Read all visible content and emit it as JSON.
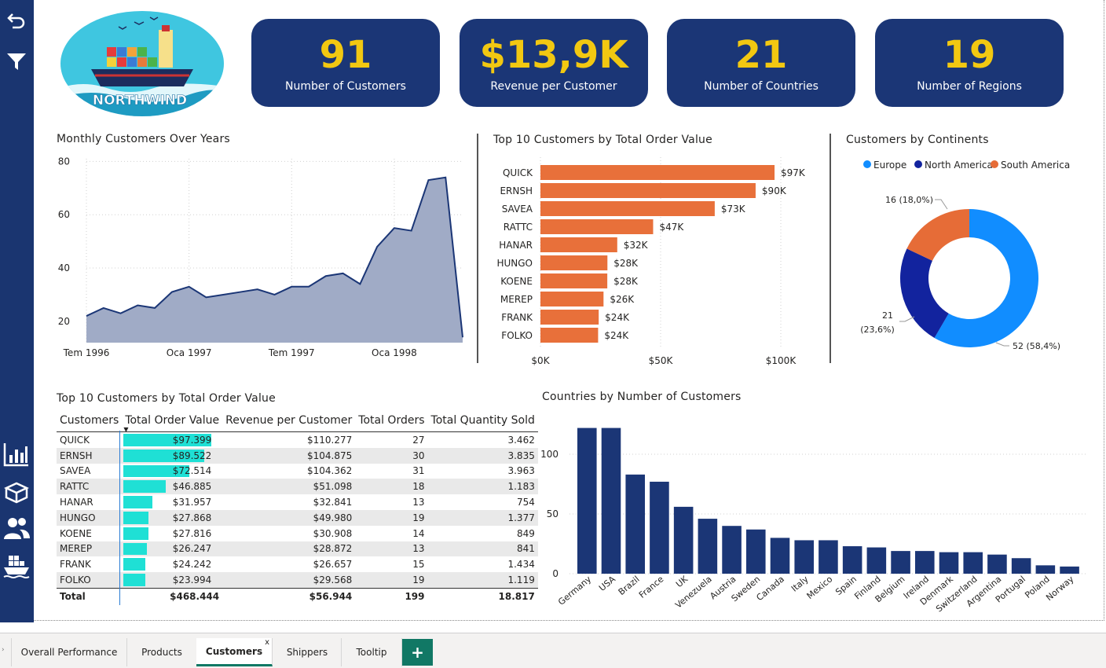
{
  "logo": {
    "text": "NORTHWIND"
  },
  "kpis": [
    {
      "value": "91",
      "label": "Number of Customers"
    },
    {
      "value": "$13,9K",
      "label": "Revenue per Customer"
    },
    {
      "value": "21",
      "label": "Number of Countries"
    },
    {
      "value": "19",
      "label": "Number of Regions"
    }
  ],
  "colors": {
    "sidebar": "#1a3570",
    "kpi_bg": "#1b3676",
    "kpi_value": "#f2c811",
    "area": "#a0abc6",
    "bar_orange": "#e8703a",
    "europe": "#118dff",
    "north_america": "#12239e",
    "south_america": "#e66c37",
    "country_bar": "#1b3676",
    "table_bar": "#1fe0d5",
    "active_tab": "#117865"
  },
  "sidebar_icons": [
    "back-arrow-icon",
    "filter-icon",
    "bar-chart-icon",
    "box-icon",
    "people-icon",
    "ship-icon"
  ],
  "chart_data": [
    {
      "type": "area",
      "title": "Monthly Customers Over Years",
      "x_tick_labels": [
        "Tem 1996",
        "Oca 1997",
        "Tem 1997",
        "Oca 1998"
      ],
      "y_ticks": [
        20,
        40,
        60,
        80
      ],
      "ylim": [
        12,
        81
      ],
      "x": [
        "1996-07",
        "1996-08",
        "1996-09",
        "1996-10",
        "1996-11",
        "1996-12",
        "1997-01",
        "1997-02",
        "1997-03",
        "1997-04",
        "1997-05",
        "1997-06",
        "1997-07",
        "1997-08",
        "1997-09",
        "1997-10",
        "1997-11",
        "1997-12",
        "1998-01",
        "1998-02",
        "1998-03",
        "1998-04",
        "1998-05"
      ],
      "values": [
        22,
        25,
        23,
        26,
        25,
        31,
        33,
        29,
        30,
        31,
        32,
        30,
        33,
        33,
        37,
        38,
        34,
        48,
        55,
        54,
        73,
        74,
        14
      ],
      "grid": true
    },
    {
      "type": "bar",
      "orientation": "horizontal",
      "title": "Top 10 Customers by Total Order Value",
      "categories": [
        "QUICK",
        "ERNSH",
        "SAVEA",
        "RATTC",
        "HANAR",
        "HUNGO",
        "KOENE",
        "MEREP",
        "FRANK",
        "FOLKO"
      ],
      "values": [
        97399,
        89522,
        72514,
        46885,
        31957,
        27868,
        27816,
        26247,
        24242,
        23994
      ],
      "data_labels": [
        "$97K",
        "$90K",
        "$73K",
        "$47K",
        "$32K",
        "$28K",
        "$28K",
        "$26K",
        "$24K",
        "$24K"
      ],
      "x_tick_labels": [
        "$0K",
        "$50K",
        "$100K"
      ],
      "xlim": [
        0,
        100000
      ],
      "grid": true
    },
    {
      "type": "pie",
      "style": "donut",
      "title": "Customers by Continents",
      "legend_position": "top",
      "categories": [
        "Europe",
        "North America",
        "South America"
      ],
      "values": [
        52,
        21,
        16
      ],
      "data_labels": [
        "52 (58,4%)",
        "21 (23,6%)",
        "16 (18,0%)"
      ]
    },
    {
      "type": "bar",
      "title": "Countries by Number of Customers",
      "categories": [
        "Germany",
        "USA",
        "Brazil",
        "France",
        "UK",
        "Venezuela",
        "Austria",
        "Sweden",
        "Canada",
        "Italy",
        "Mexico",
        "Spain",
        "Finland",
        "Belgium",
        "Ireland",
        "Denmark",
        "Switzerland",
        "Argentina",
        "Portugal",
        "Poland",
        "Norway"
      ],
      "values": [
        122,
        122,
        83,
        77,
        56,
        46,
        40,
        37,
        30,
        28,
        28,
        23,
        22,
        19,
        19,
        18,
        18,
        16,
        13,
        7,
        6
      ],
      "y_ticks": [
        0,
        50,
        100
      ],
      "ylim": [
        0,
        125
      ],
      "grid": true
    }
  ],
  "table": {
    "title": "Top 10 Customers by Total Order Value",
    "columns": [
      "Customers",
      "Total Order Value",
      "Revenue per Customer",
      "Total Orders",
      "Total Quantity Sold"
    ],
    "rows": [
      [
        "QUICK",
        "$97.399",
        "$110.277",
        "27",
        "3.462"
      ],
      [
        "ERNSH",
        "$89.522",
        "$104.875",
        "30",
        "3.835"
      ],
      [
        "SAVEA",
        "$72.514",
        "$104.362",
        "31",
        "3.963"
      ],
      [
        "RATTC",
        "$46.885",
        "$51.098",
        "18",
        "1.183"
      ],
      [
        "HANAR",
        "$31.957",
        "$32.841",
        "13",
        "754"
      ],
      [
        "HUNGO",
        "$27.868",
        "$49.980",
        "19",
        "1.377"
      ],
      [
        "KOENE",
        "$27.816",
        "$30.908",
        "14",
        "849"
      ],
      [
        "MEREP",
        "$26.247",
        "$28.872",
        "13",
        "841"
      ],
      [
        "FRANK",
        "$24.242",
        "$26.657",
        "15",
        "1.434"
      ],
      [
        "FOLKO",
        "$23.994",
        "$29.568",
        "19",
        "1.119"
      ]
    ],
    "bar_fraction": [
      1.0,
      0.919,
      0.745,
      0.481,
      0.328,
      0.286,
      0.286,
      0.269,
      0.249,
      0.246
    ],
    "total": [
      "Total",
      "$468.444",
      "$56.944",
      "199",
      "18.817"
    ]
  },
  "tabs": {
    "items": [
      "Overall Performance",
      "Products",
      "Customers",
      "Shippers",
      "Tooltip"
    ],
    "active": "Customers",
    "close_glyph": "x",
    "add_glyph": "+"
  }
}
